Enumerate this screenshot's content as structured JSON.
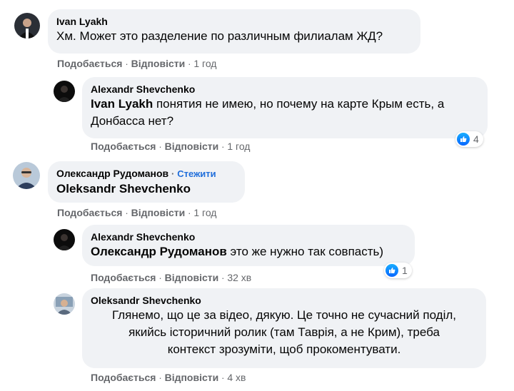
{
  "labels": {
    "like": "Подобається",
    "reply": "Відповісти",
    "sep": "·",
    "follow": "Стежити"
  },
  "comments": [
    {
      "author": "Ivan Lyakh",
      "text": "Хм. Может это разделение по различным филиалам ЖД?",
      "time": "1 год"
    },
    {
      "author": "Alexandr Shevchenko",
      "mention": "Ivan Lyakh",
      "text_line1": " понятия не имею, но почему на карте Крым есть, а",
      "text_line2": "Донбасса нет?",
      "time": "1 год",
      "reactions": "4"
    },
    {
      "author": "Олександр Рудоманов",
      "mention": "Oleksandr Shevchenko",
      "time": "1 год"
    },
    {
      "author": "Alexandr Shevchenko",
      "mention": "Олександр Рудоманов",
      "text": " это же нужно так совпасть)",
      "time": "32 хв",
      "reactions": "1"
    },
    {
      "author": "Oleksandr Shevchenko",
      "text_lines": [
        "Глянемо, що це за відео, дякую. Це точно не сучасний поділ,",
        "якийсь історичний ролик (там Таврія, а не Крим), треба",
        "контекст зрозуміти, щоб прокоментувати."
      ],
      "time": "4 хв"
    }
  ],
  "colors": {
    "bubble": "#f0f2f5",
    "link": "#216fdb",
    "meta": "#65676b",
    "like": "#0866ff"
  }
}
